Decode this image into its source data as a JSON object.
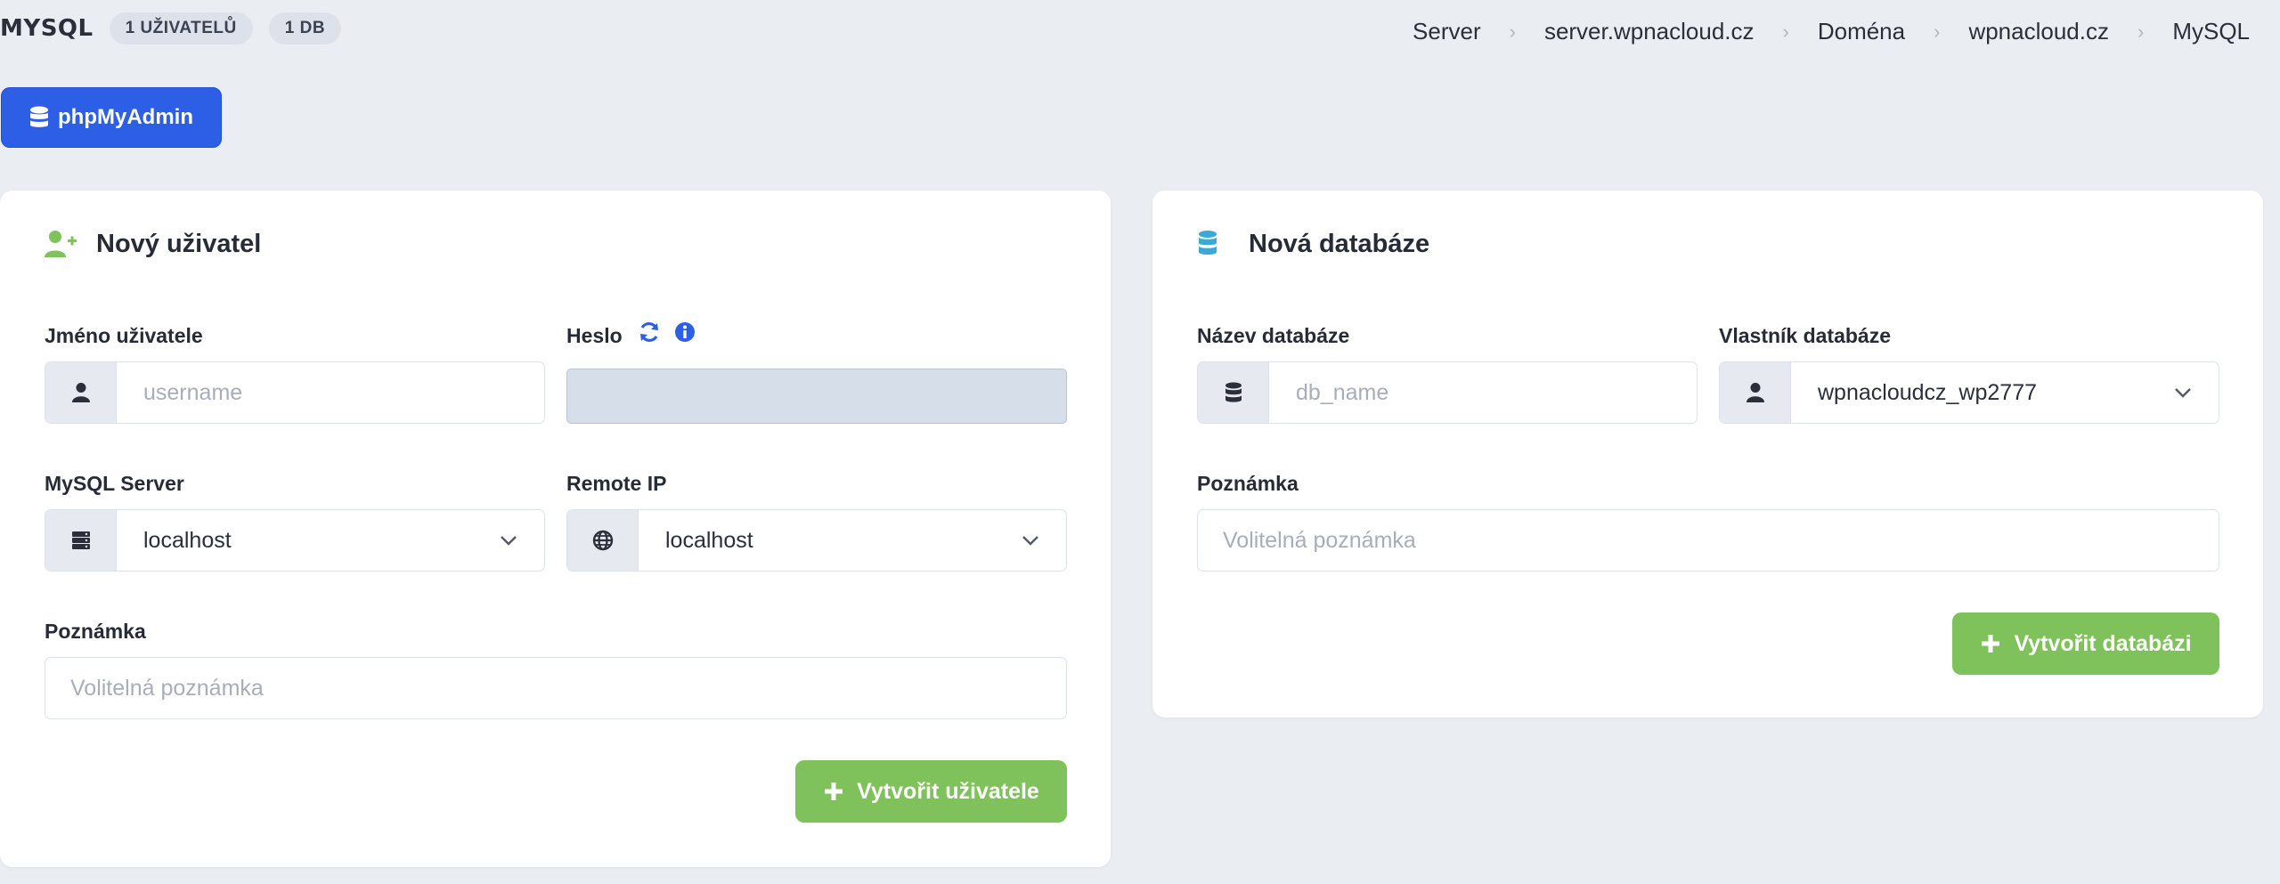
{
  "header": {
    "title": "MYSQL",
    "badges": [
      "1 UŽIVATELŮ",
      "1 DB"
    ],
    "breadcrumb": [
      "Server",
      "server.wpnacloud.cz",
      "Doména",
      "wpnacloud.cz",
      "MySQL"
    ],
    "phpmyadmin_label": "phpMyAdmin"
  },
  "user_card": {
    "title": "Nový uživatel",
    "username_label": "Jméno uživatele",
    "username_placeholder": "username",
    "password_label": "Heslo",
    "server_label": "MySQL Server",
    "server_value": "localhost",
    "remote_label": "Remote IP",
    "remote_value": "localhost",
    "note_label": "Poznámka",
    "note_placeholder": "Volitelná poznámka",
    "submit_label": "Vytvořit uživatele"
  },
  "db_card": {
    "title": "Nová databáze",
    "name_label": "Název databáze",
    "name_placeholder": "db_name",
    "owner_label": "Vlastník databáze",
    "owner_value": "wpnacloudcz_wp2777",
    "note_label": "Poznámka",
    "note_placeholder": "Volitelná poznámka",
    "submit_label": "Vytvořit databázi"
  },
  "colors": {
    "primary": "#2c5ee6",
    "success": "#7fc15a",
    "background": "#eaedf2",
    "user_icon": "#7fc15a",
    "db_icon": "#3aa8d8"
  }
}
